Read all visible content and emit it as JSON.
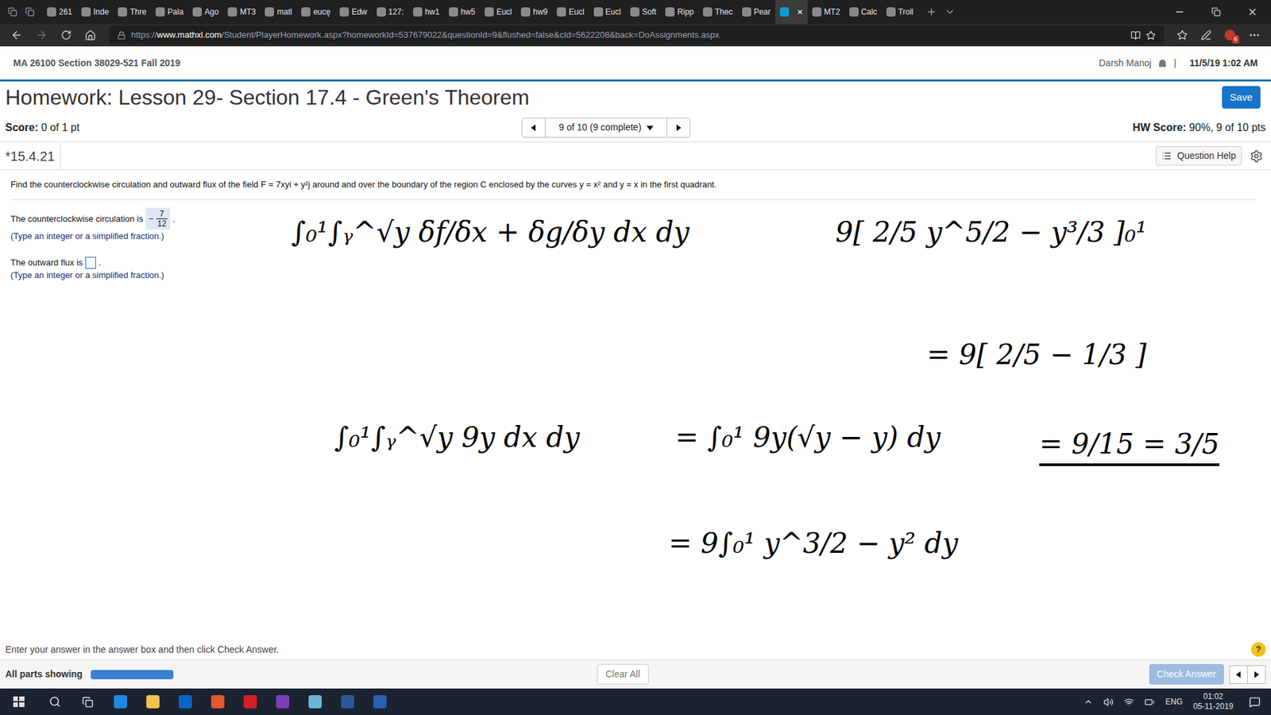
{
  "browser": {
    "tabs": [
      {
        "label": "261",
        "selected": false
      },
      {
        "label": "Inde",
        "selected": false
      },
      {
        "label": "Thre",
        "selected": false
      },
      {
        "label": "Pala",
        "selected": false
      },
      {
        "label": "Ago",
        "selected": false
      },
      {
        "label": "MT3",
        "selected": false
      },
      {
        "label": "matl",
        "selected": false
      },
      {
        "label": "eucę",
        "selected": false
      },
      {
        "label": "Edw",
        "selected": false
      },
      {
        "label": "127:",
        "selected": false
      },
      {
        "label": "hw1",
        "selected": false
      },
      {
        "label": "hw5",
        "selected": false
      },
      {
        "label": "Eucl",
        "selected": false
      },
      {
        "label": "hw9",
        "selected": false
      },
      {
        "label": "Eucl",
        "selected": false
      },
      {
        "label": "Eucl",
        "selected": false
      },
      {
        "label": "Soft",
        "selected": false
      },
      {
        "label": "Ripp",
        "selected": false
      },
      {
        "label": "Thec",
        "selected": false
      },
      {
        "label": "Pear",
        "selected": false
      },
      {
        "label": "×",
        "selected": true
      },
      {
        "label": "MT2",
        "selected": false
      },
      {
        "label": "Calc",
        "selected": false
      },
      {
        "label": "Troll",
        "selected": false
      }
    ],
    "address": {
      "scheme": "https://",
      "host": "www.mathxl.com",
      "path": "/Student/PlayerHomework.aspx?homeworkId=537679022&questionId=9&flushed=false&cId=5622208&back=DoAssignments.aspx"
    },
    "extension_badge": "6"
  },
  "page": {
    "course": "MA 26100 Section 38029-521 Fall 2019",
    "user": "Darsh Manoj",
    "separator": "|",
    "datetime": "11/5/19 1:02 AM",
    "title": "Homework: Lesson 29- Section 17.4 - Green's Theorem",
    "save_button": "Save",
    "score_label": "Score:",
    "score": "0 of 1 pt",
    "nav": "9 of 10 (9 complete)",
    "hw_score_label": "HW Score:",
    "hw_score": "90%, 9 of 10 pts",
    "question_id": "*15.4.21",
    "question_help": "Question Help",
    "question": "Find the counterclockwise circulation and outward flux of the field F = 7xyi + y²j around and over the boundary of the region C enclosed by the curves y = x² and y = x in the first quadrant.",
    "answers": [
      {
        "label": "The counterclockwise circulation is",
        "sign": "−",
        "numerator": "7",
        "denominator": "12",
        "filled": true,
        "end": ".",
        "hint": "(Type an integer or a simplified fraction.)"
      },
      {
        "label": "The outward flux is",
        "sign": "",
        "numerator": "",
        "denominator": "",
        "filled": false,
        "end": ".",
        "hint": "(Type an integer or a simplified fraction.)"
      }
    ],
    "instruction": "Enter your answer in the answer box and then click Check Answer.",
    "help_glyph": "?",
    "parts_label": "All parts showing",
    "parts_level": 1,
    "clear_all": "Clear All",
    "check_answer": "Check Answer",
    "check_disabled": true
  },
  "ink": [
    "∫₀¹∫ᵧ^√y  δf/δx + δg/δy  dx dy",
    "9[ 2/5 y^5/2 − y³/3 ]₀¹",
    "= 9[ 2/5 − 1/3 ]",
    "∫₀¹∫ᵧ^√y 9y dx dy",
    "= ∫₀¹ 9y(√y − y) dy",
    "= 9/15 = 3/5",
    "= 9∫₀¹ y^3/2 − y² dy"
  ],
  "taskbar": {
    "language": "ENG",
    "time": "01:02",
    "date": "05-11-2019"
  }
}
